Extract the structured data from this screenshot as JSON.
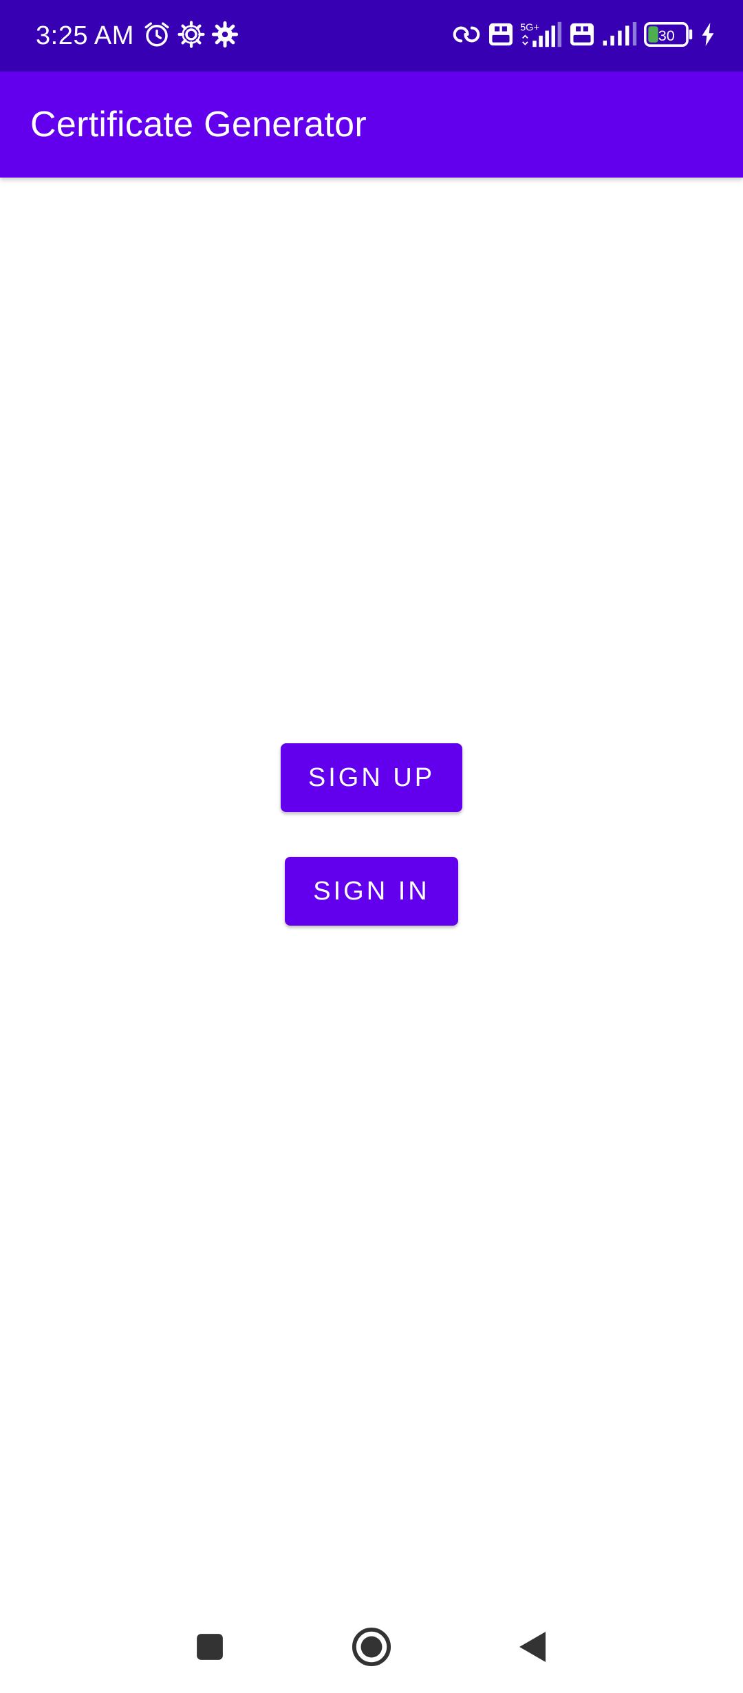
{
  "status_bar": {
    "time": "3:25 AM",
    "battery_level": "30",
    "network_label": "5G+",
    "volte_label": "Vo LTE",
    "background_color": "#3700B3",
    "icons": [
      "alarm-icon",
      "settings-gear-outline-icon",
      "settings-gear-icon",
      "link-icon",
      "volte-icon",
      "signal-icon",
      "volte-icon",
      "signal-icon",
      "battery-icon",
      "charging-icon"
    ]
  },
  "app_bar": {
    "title": "Certificate Generator",
    "color": "#6200EE"
  },
  "main": {
    "sign_up_label": "SIGN UP",
    "sign_in_label": "SIGN IN",
    "button_color": "#6200EE"
  },
  "nav_bar": {
    "icons": [
      "recents-square-icon",
      "home-circle-icon",
      "back-triangle-icon"
    ]
  }
}
